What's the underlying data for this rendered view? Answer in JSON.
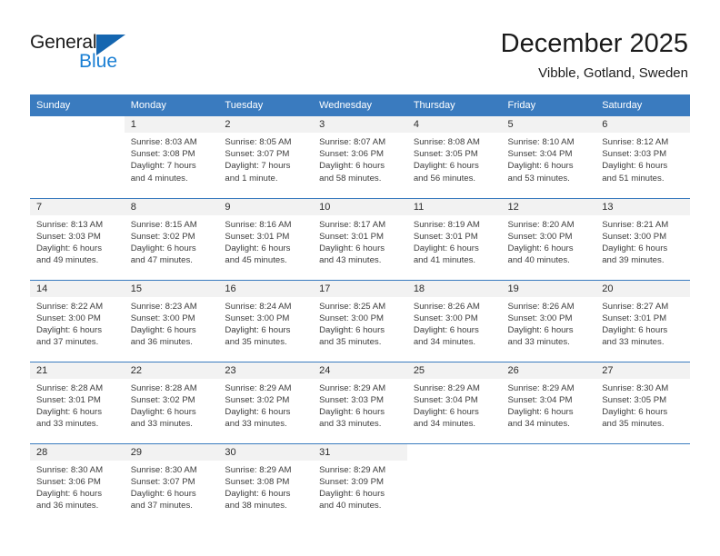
{
  "brand": {
    "name_part1": "General",
    "name_part2": "Blue",
    "triangle_color": "#1566b0",
    "blue_color": "#1a7fd4"
  },
  "header": {
    "title": "December 2025",
    "subtitle": "Vibble, Gotland, Sweden"
  },
  "theme": {
    "header_blue": "#3a7bbf",
    "daynum_bg": "#f2f2f2",
    "text": "#3d3d3d"
  },
  "weekday_headers": [
    "Sunday",
    "Monday",
    "Tuesday",
    "Wednesday",
    "Thursday",
    "Friday",
    "Saturday"
  ],
  "weeks": [
    [
      {
        "day": "",
        "sunrise": "",
        "sunset": "",
        "daylight_line1": "",
        "daylight_line2": ""
      },
      {
        "day": "1",
        "sunrise": "Sunrise: 8:03 AM",
        "sunset": "Sunset: 3:08 PM",
        "daylight_line1": "Daylight: 7 hours",
        "daylight_line2": "and 4 minutes."
      },
      {
        "day": "2",
        "sunrise": "Sunrise: 8:05 AM",
        "sunset": "Sunset: 3:07 PM",
        "daylight_line1": "Daylight: 7 hours",
        "daylight_line2": "and 1 minute."
      },
      {
        "day": "3",
        "sunrise": "Sunrise: 8:07 AM",
        "sunset": "Sunset: 3:06 PM",
        "daylight_line1": "Daylight: 6 hours",
        "daylight_line2": "and 58 minutes."
      },
      {
        "day": "4",
        "sunrise": "Sunrise: 8:08 AM",
        "sunset": "Sunset: 3:05 PM",
        "daylight_line1": "Daylight: 6 hours",
        "daylight_line2": "and 56 minutes."
      },
      {
        "day": "5",
        "sunrise": "Sunrise: 8:10 AM",
        "sunset": "Sunset: 3:04 PM",
        "daylight_line1": "Daylight: 6 hours",
        "daylight_line2": "and 53 minutes."
      },
      {
        "day": "6",
        "sunrise": "Sunrise: 8:12 AM",
        "sunset": "Sunset: 3:03 PM",
        "daylight_line1": "Daylight: 6 hours",
        "daylight_line2": "and 51 minutes."
      }
    ],
    [
      {
        "day": "7",
        "sunrise": "Sunrise: 8:13 AM",
        "sunset": "Sunset: 3:03 PM",
        "daylight_line1": "Daylight: 6 hours",
        "daylight_line2": "and 49 minutes."
      },
      {
        "day": "8",
        "sunrise": "Sunrise: 8:15 AM",
        "sunset": "Sunset: 3:02 PM",
        "daylight_line1": "Daylight: 6 hours",
        "daylight_line2": "and 47 minutes."
      },
      {
        "day": "9",
        "sunrise": "Sunrise: 8:16 AM",
        "sunset": "Sunset: 3:01 PM",
        "daylight_line1": "Daylight: 6 hours",
        "daylight_line2": "and 45 minutes."
      },
      {
        "day": "10",
        "sunrise": "Sunrise: 8:17 AM",
        "sunset": "Sunset: 3:01 PM",
        "daylight_line1": "Daylight: 6 hours",
        "daylight_line2": "and 43 minutes."
      },
      {
        "day": "11",
        "sunrise": "Sunrise: 8:19 AM",
        "sunset": "Sunset: 3:01 PM",
        "daylight_line1": "Daylight: 6 hours",
        "daylight_line2": "and 41 minutes."
      },
      {
        "day": "12",
        "sunrise": "Sunrise: 8:20 AM",
        "sunset": "Sunset: 3:00 PM",
        "daylight_line1": "Daylight: 6 hours",
        "daylight_line2": "and 40 minutes."
      },
      {
        "day": "13",
        "sunrise": "Sunrise: 8:21 AM",
        "sunset": "Sunset: 3:00 PM",
        "daylight_line1": "Daylight: 6 hours",
        "daylight_line2": "and 39 minutes."
      }
    ],
    [
      {
        "day": "14",
        "sunrise": "Sunrise: 8:22 AM",
        "sunset": "Sunset: 3:00 PM",
        "daylight_line1": "Daylight: 6 hours",
        "daylight_line2": "and 37 minutes."
      },
      {
        "day": "15",
        "sunrise": "Sunrise: 8:23 AM",
        "sunset": "Sunset: 3:00 PM",
        "daylight_line1": "Daylight: 6 hours",
        "daylight_line2": "and 36 minutes."
      },
      {
        "day": "16",
        "sunrise": "Sunrise: 8:24 AM",
        "sunset": "Sunset: 3:00 PM",
        "daylight_line1": "Daylight: 6 hours",
        "daylight_line2": "and 35 minutes."
      },
      {
        "day": "17",
        "sunrise": "Sunrise: 8:25 AM",
        "sunset": "Sunset: 3:00 PM",
        "daylight_line1": "Daylight: 6 hours",
        "daylight_line2": "and 35 minutes."
      },
      {
        "day": "18",
        "sunrise": "Sunrise: 8:26 AM",
        "sunset": "Sunset: 3:00 PM",
        "daylight_line1": "Daylight: 6 hours",
        "daylight_line2": "and 34 minutes."
      },
      {
        "day": "19",
        "sunrise": "Sunrise: 8:26 AM",
        "sunset": "Sunset: 3:00 PM",
        "daylight_line1": "Daylight: 6 hours",
        "daylight_line2": "and 33 minutes."
      },
      {
        "day": "20",
        "sunrise": "Sunrise: 8:27 AM",
        "sunset": "Sunset: 3:01 PM",
        "daylight_line1": "Daylight: 6 hours",
        "daylight_line2": "and 33 minutes."
      }
    ],
    [
      {
        "day": "21",
        "sunrise": "Sunrise: 8:28 AM",
        "sunset": "Sunset: 3:01 PM",
        "daylight_line1": "Daylight: 6 hours",
        "daylight_line2": "and 33 minutes."
      },
      {
        "day": "22",
        "sunrise": "Sunrise: 8:28 AM",
        "sunset": "Sunset: 3:02 PM",
        "daylight_line1": "Daylight: 6 hours",
        "daylight_line2": "and 33 minutes."
      },
      {
        "day": "23",
        "sunrise": "Sunrise: 8:29 AM",
        "sunset": "Sunset: 3:02 PM",
        "daylight_line1": "Daylight: 6 hours",
        "daylight_line2": "and 33 minutes."
      },
      {
        "day": "24",
        "sunrise": "Sunrise: 8:29 AM",
        "sunset": "Sunset: 3:03 PM",
        "daylight_line1": "Daylight: 6 hours",
        "daylight_line2": "and 33 minutes."
      },
      {
        "day": "25",
        "sunrise": "Sunrise: 8:29 AM",
        "sunset": "Sunset: 3:04 PM",
        "daylight_line1": "Daylight: 6 hours",
        "daylight_line2": "and 34 minutes."
      },
      {
        "day": "26",
        "sunrise": "Sunrise: 8:29 AM",
        "sunset": "Sunset: 3:04 PM",
        "daylight_line1": "Daylight: 6 hours",
        "daylight_line2": "and 34 minutes."
      },
      {
        "day": "27",
        "sunrise": "Sunrise: 8:30 AM",
        "sunset": "Sunset: 3:05 PM",
        "daylight_line1": "Daylight: 6 hours",
        "daylight_line2": "and 35 minutes."
      }
    ],
    [
      {
        "day": "28",
        "sunrise": "Sunrise: 8:30 AM",
        "sunset": "Sunset: 3:06 PM",
        "daylight_line1": "Daylight: 6 hours",
        "daylight_line2": "and 36 minutes."
      },
      {
        "day": "29",
        "sunrise": "Sunrise: 8:30 AM",
        "sunset": "Sunset: 3:07 PM",
        "daylight_line1": "Daylight: 6 hours",
        "daylight_line2": "and 37 minutes."
      },
      {
        "day": "30",
        "sunrise": "Sunrise: 8:29 AM",
        "sunset": "Sunset: 3:08 PM",
        "daylight_line1": "Daylight: 6 hours",
        "daylight_line2": "and 38 minutes."
      },
      {
        "day": "31",
        "sunrise": "Sunrise: 8:29 AM",
        "sunset": "Sunset: 3:09 PM",
        "daylight_line1": "Daylight: 6 hours",
        "daylight_line2": "and 40 minutes."
      },
      {
        "day": "",
        "sunrise": "",
        "sunset": "",
        "daylight_line1": "",
        "daylight_line2": ""
      },
      {
        "day": "",
        "sunrise": "",
        "sunset": "",
        "daylight_line1": "",
        "daylight_line2": ""
      },
      {
        "day": "",
        "sunrise": "",
        "sunset": "",
        "daylight_line1": "",
        "daylight_line2": ""
      }
    ]
  ]
}
